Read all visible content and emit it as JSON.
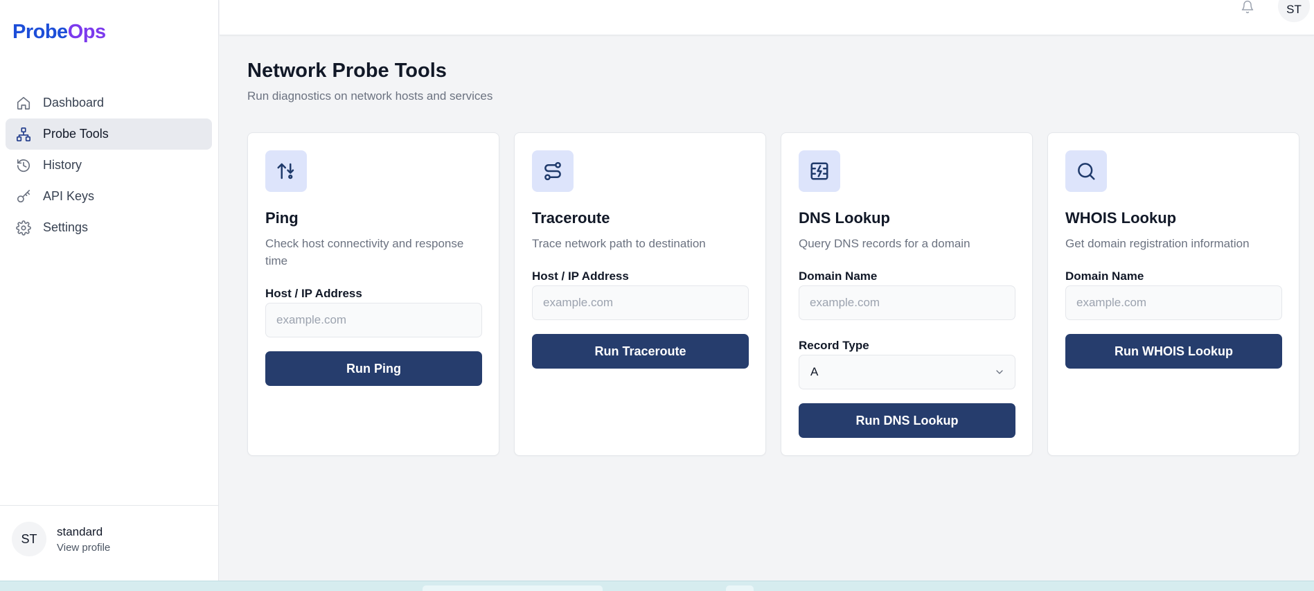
{
  "app": {
    "logo_part1": "Probe",
    "logo_part2": "Ops"
  },
  "sidebar": {
    "items": [
      {
        "label": "Dashboard",
        "icon": "home-icon",
        "active": false
      },
      {
        "label": "Probe Tools",
        "icon": "network-icon",
        "active": true
      },
      {
        "label": "History",
        "icon": "history-icon",
        "active": false
      },
      {
        "label": "API Keys",
        "icon": "key-icon",
        "active": false
      },
      {
        "label": "Settings",
        "icon": "gear-icon",
        "active": false
      }
    ],
    "user": {
      "initials": "ST",
      "name": "standard",
      "profile_link": "View profile"
    }
  },
  "header": {
    "bell_icon": "bell-icon",
    "avatar_initials": "ST"
  },
  "main": {
    "title": "Network Probe Tools",
    "subtitle": "Run diagnostics on network hosts and services",
    "cards": [
      {
        "icon": "arrows-up-down-icon",
        "title": "Ping",
        "description": "Check host connectivity and response time",
        "field_label": "Host / IP Address",
        "placeholder": "example.com",
        "button": "Run Ping"
      },
      {
        "icon": "route-icon",
        "title": "Traceroute",
        "description": "Trace network path to destination",
        "field_label": "Host / IP Address",
        "placeholder": "example.com",
        "button": "Run Traceroute"
      },
      {
        "icon": "server-icon",
        "title": "DNS Lookup",
        "description": "Query DNS records for a domain",
        "field_label": "Domain Name",
        "placeholder": "example.com",
        "select_label": "Record Type",
        "select_value": "A",
        "button": "Run DNS Lookup"
      },
      {
        "icon": "search-icon",
        "title": "WHOIS Lookup",
        "description": "Get domain registration information",
        "field_label": "Domain Name",
        "placeholder": "example.com",
        "button": "Run WHOIS Lookup"
      }
    ]
  },
  "colors": {
    "accent": "#263d6d",
    "logo_blue": "#1d4ed8",
    "logo_purple": "#7c3aed",
    "icon_bg": "#dde4fb",
    "page_bg": "#f3f4f6"
  }
}
